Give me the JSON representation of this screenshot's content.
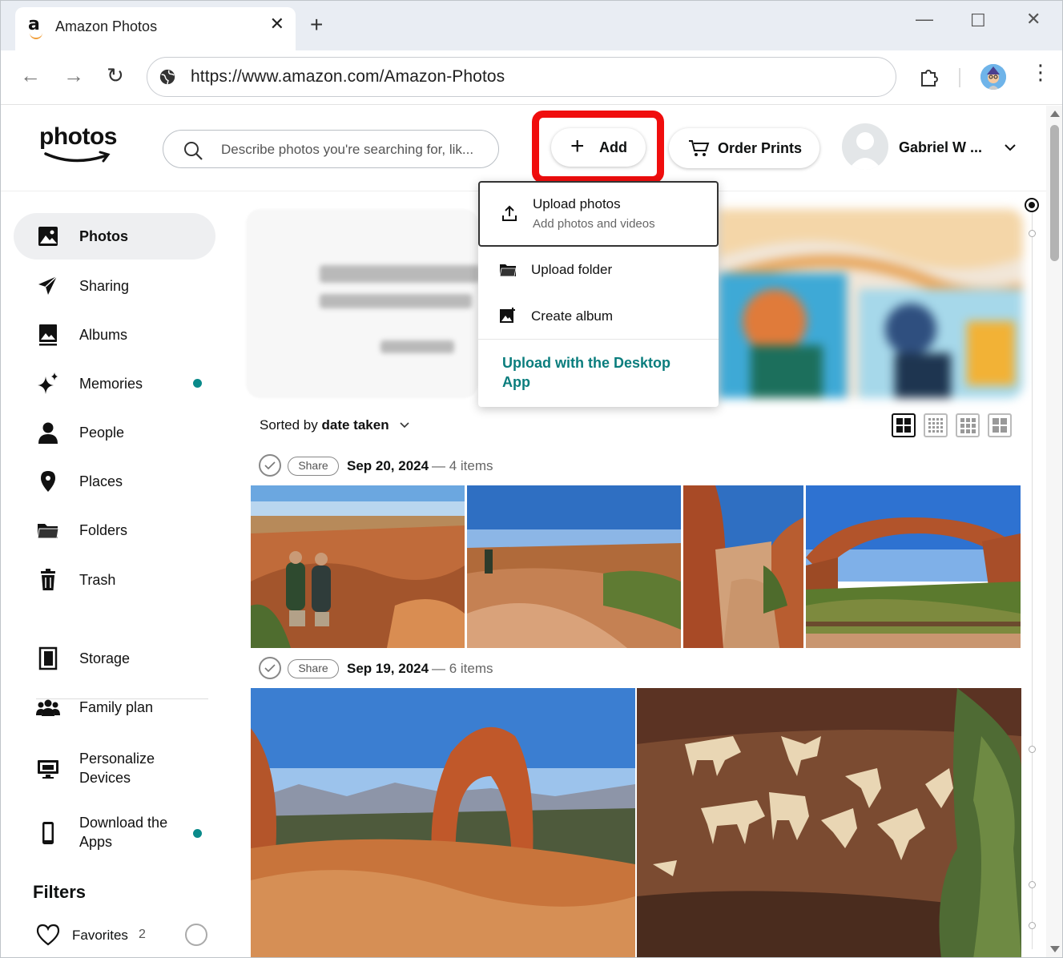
{
  "browser": {
    "tab_title": "Amazon Photos",
    "new_tab": "+",
    "close_tab": "✕",
    "url": "https://www.amazon.com/Amazon-Photos",
    "window_controls": {
      "minimize": "—",
      "maximize": "☐",
      "close": "✕"
    },
    "nav": {
      "back": "←",
      "forward": "→",
      "reload": "↻"
    },
    "menu": "⋮"
  },
  "header": {
    "logo_text": "photos",
    "search_placeholder": "Describe photos you're searching for, lik...",
    "add_label": "Add",
    "order_prints_label": "Order Prints",
    "user_name": "Gabriel W ..."
  },
  "sidebar": {
    "items": [
      {
        "label": "Photos",
        "icon": "photos-icon",
        "active": true
      },
      {
        "label": "Sharing",
        "icon": "paper-plane-icon"
      },
      {
        "label": "Albums",
        "icon": "albums-icon"
      },
      {
        "label": "Memories",
        "icon": "sparkle-icon",
        "dot": true
      },
      {
        "label": "People",
        "icon": "person-icon"
      },
      {
        "label": "Places",
        "icon": "location-pin-icon"
      },
      {
        "label": "Folders",
        "icon": "folder-icon"
      },
      {
        "label": "Trash",
        "icon": "trash-icon"
      },
      {
        "label": "Storage",
        "icon": "storage-icon"
      },
      {
        "label": "Family plan",
        "icon": "family-icon"
      },
      {
        "label": "Personalize Devices",
        "icon": "monitor-icon"
      },
      {
        "label": "Download the Apps",
        "icon": "phone-icon",
        "dot": true
      }
    ],
    "filters_title": "Filters",
    "favorites_label": "Favorites",
    "favorites_count": "2"
  },
  "dropdown": {
    "upload_photos": "Upload photos",
    "upload_photos_sub": "Add photos and videos",
    "upload_folder": "Upload folder",
    "create_album": "Create album",
    "desktop_app": "Upload with the Desktop App"
  },
  "main": {
    "sort_prefix": "Sorted by",
    "sort_value": "date taken",
    "groups": [
      {
        "share": "Share",
        "date": "Sep 20, 2024",
        "count": "— 4 items"
      },
      {
        "share": "Share",
        "date": "Sep 19, 2024",
        "count": "— 6 items"
      }
    ]
  },
  "colors": {
    "accent_teal": "#0a7d7d",
    "highlight_red": "#f00d0d",
    "active_bg": "#eeeff1"
  }
}
